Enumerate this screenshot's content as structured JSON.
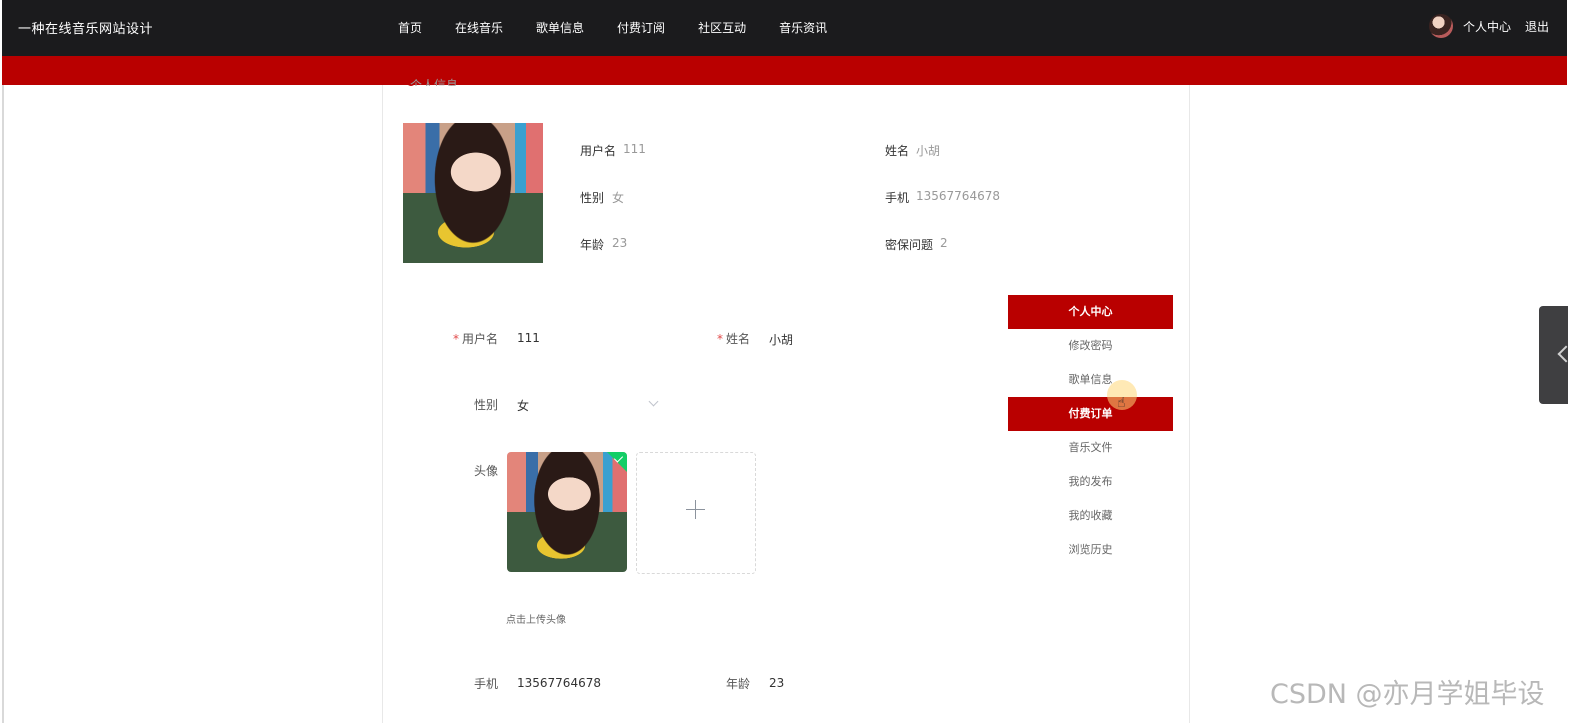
{
  "header": {
    "site_title": "一种在线音乐网站设计",
    "nav": [
      "首页",
      "在线音乐",
      "歌单信息",
      "付费订阅",
      "社区互动",
      "音乐资讯"
    ],
    "user_center": "个人中心",
    "logout": "退出"
  },
  "section": {
    "title": "个人信息"
  },
  "profile": {
    "username": {
      "label": "用户名",
      "value": "111"
    },
    "name": {
      "label": "姓名",
      "value": "小胡"
    },
    "gender": {
      "label": "性别",
      "value": "女"
    },
    "phone": {
      "label": "手机",
      "value": "13567764678"
    },
    "age": {
      "label": "年龄",
      "value": "23"
    },
    "security_question": {
      "label": "密保问题",
      "value": "2"
    }
  },
  "form": {
    "username": {
      "label": "用户名",
      "value": "111",
      "required": true
    },
    "name": {
      "label": "姓名",
      "value": "小胡",
      "required": true
    },
    "gender": {
      "label": "性别",
      "value": "女"
    },
    "avatar": {
      "label": "头像",
      "hint": "点击上传头像"
    },
    "phone": {
      "label": "手机",
      "value": "13567764678"
    },
    "age": {
      "label": "年龄",
      "value": "23"
    }
  },
  "side_menu": [
    {
      "label": "个人中心",
      "active": true
    },
    {
      "label": "修改密码",
      "active": false
    },
    {
      "label": "歌单信息",
      "active": false
    },
    {
      "label": "付费订单",
      "active": true
    },
    {
      "label": "音乐文件",
      "active": false
    },
    {
      "label": "我的发布",
      "active": false
    },
    {
      "label": "我的收藏",
      "active": false
    },
    {
      "label": "浏览历史",
      "active": false
    }
  ],
  "watermark": "CSDN @亦月学姐毕设",
  "colors": {
    "header_bg": "#1b1b1d",
    "accent_red": "#b90000",
    "success_green": "#13ce66"
  },
  "icons": [
    "plus-icon",
    "chevron-down-icon",
    "check-icon",
    "hand-cursor-icon",
    "chevron-left-icon"
  ]
}
